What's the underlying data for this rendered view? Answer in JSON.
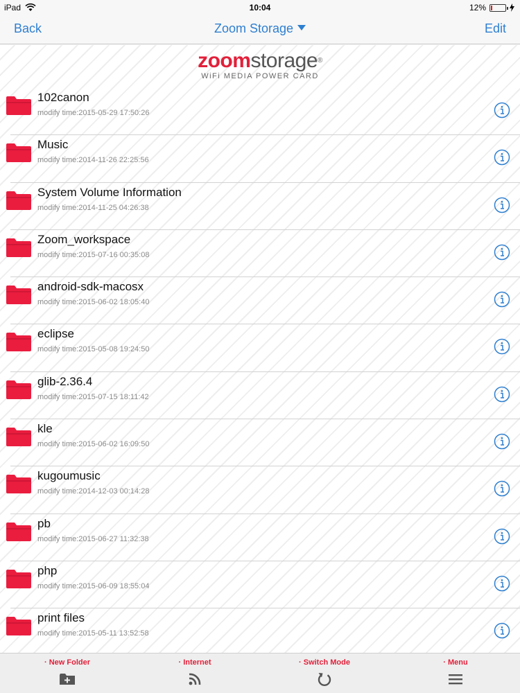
{
  "status_bar": {
    "device": "iPad",
    "time": "10:04",
    "battery": "12%",
    "battery_level": 0.12
  },
  "nav": {
    "back_label": "Back",
    "title": "Zoom Storage",
    "edit_label": "Edit"
  },
  "logo": {
    "brand_zoom": "zoom",
    "brand_storage": "storage",
    "registered": "®",
    "tagline": "WiFi MEDIA POWER CARD"
  },
  "files": [
    {
      "name": "102canon",
      "time": "modify time:2015-05-29 17:50:26"
    },
    {
      "name": "Music",
      "time": "modify time:2014-11-26 22:25:56"
    },
    {
      "name": "System Volume Information",
      "time": "modify time:2014-11-25 04:26:38"
    },
    {
      "name": "Zoom_workspace",
      "time": "modify time:2015-07-16 00:35:08"
    },
    {
      "name": "android-sdk-macosx",
      "time": "modify time:2015-06-02 18:05:40"
    },
    {
      "name": "eclipse",
      "time": "modify time:2015-05-08 19:24:50"
    },
    {
      "name": "glib-2.36.4",
      "time": "modify time:2015-07-15 18:11:42"
    },
    {
      "name": "kle",
      "time": "modify time:2015-06-02 16:09:50"
    },
    {
      "name": "kugoumusic",
      "time": "modify time:2014-12-03 00:14:28"
    },
    {
      "name": "pb",
      "time": "modify time:2015-06-27 11:32:38"
    },
    {
      "name": "php",
      "time": "modify time:2015-06-09 18:55:04"
    },
    {
      "name": "print files",
      "time": "modify time:2015-05-11 13:52:58"
    }
  ],
  "toolbar": {
    "new_folder": "· New Folder",
    "internet": "· Internet",
    "switch_mode": "· Switch Mode",
    "menu": "· Menu"
  },
  "colors": {
    "accent_blue": "#2e7fd0",
    "brand_red": "#e2203a",
    "folder_red": "#ea1d3f"
  },
  "icons": {
    "row_icon": "folder-icon",
    "row_action": "info-icon",
    "toolbar": [
      "new-folder-icon",
      "rss-icon",
      "refresh-icon",
      "hamburger-menu-icon"
    ]
  }
}
